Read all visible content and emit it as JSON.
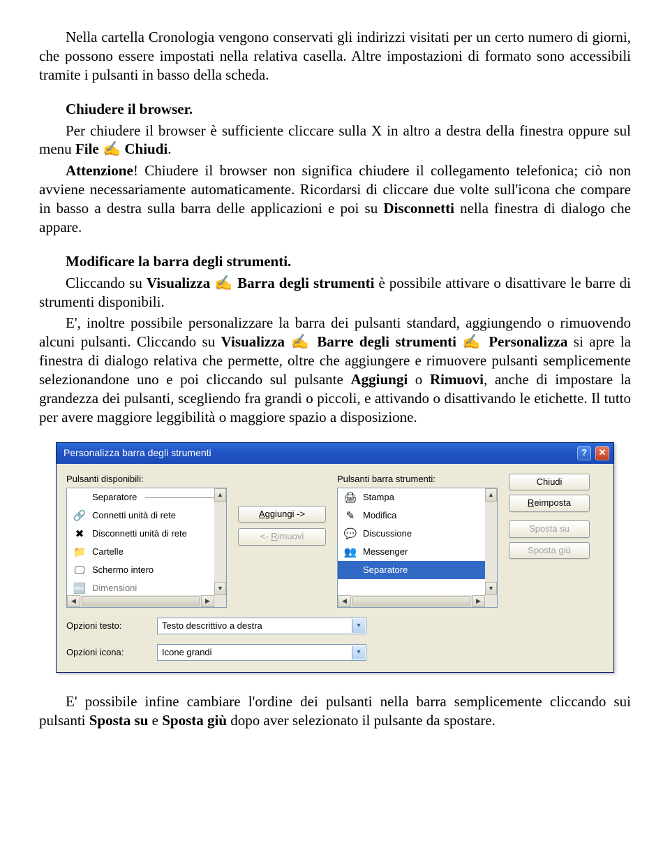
{
  "para": {
    "p1": "Nella cartella Cronologia vengono conservati gli indirizzi visitati per un certo numero di giorni, che possono essere impostati nella relativa casella. Altre impostazioni di formato sono accessibili tramite i pulsanti in basso della scheda.",
    "h1": "Chiudere il browser.",
    "p2a": "Per chiudere il browser è sufficiente cliccare sulla X in altro a destra della finestra oppure sul menu ",
    "p2b": "File ✍ Chiudi",
    "p2c": ".",
    "p3a": "Attenzione",
    "p3b": "! Chiudere il browser non significa chiudere il collegamento telefonica; ciò non avviene necessariamente automaticamente. Ricordarsi di cliccare due volte sull'icona che compare in basso a destra sulla barra delle applicazioni e poi su  ",
    "p3c": "Disconnetti",
    "p3d": " nella finestra di dialogo che appare.",
    "h2": "Modificare la barra degli strumenti.",
    "p4a": "Cliccando su ",
    "p4b": "Visualizza ✍ Barra degli strumenti",
    "p4c": " è possibile attivare o disattivare le barre di strumenti disponibili.",
    "p5a": "E', inoltre possibile personalizzare la barra dei pulsanti standard, aggiungendo o rimuovendo alcuni pulsanti. Cliccando su ",
    "p5b": "Visualizza ✍ Barre degli strumenti ✍ Personalizza",
    "p5c": " si apre la finestra di dialogo relativa che permette, oltre che aggiungere e rimuovere pulsanti semplicemente selezionandone uno e poi cliccando sul pulsante ",
    "p5d": "Aggiungi",
    "p5e": " o ",
    "p5f": "Rimuovi",
    "p5g": ", anche di impostare la grandezza dei pulsanti, scegliendo fra grandi o piccoli, e attivando o disattivando le etichette. Il tutto per avere maggiore leggibilità o maggiore spazio a disposizione.",
    "p6a": "E' possibile infine cambiare l'ordine dei pulsanti nella barra semplicemente cliccando sui pulsanti ",
    "p6b": "Sposta su",
    "p6c": " e ",
    "p6d": "Sposta giù",
    "p6e": " dopo aver selezionato il pulsante da spostare."
  },
  "dlg": {
    "title": "Personalizza barra degli strumenti",
    "labels": {
      "available": "Pulsanti disponibili:",
      "current": "Pulsanti barra strumenti:",
      "textopt": "Opzioni testo:",
      "iconopt": "Opzioni icona:"
    },
    "buttons": {
      "add": "Aggiungi ->",
      "remove": "<- Rimuovi",
      "close": "Chiudi",
      "reset": "Reimposta",
      "moveup": "Sposta su",
      "movedown": "Sposta giù"
    },
    "left_items": [
      {
        "icon": "",
        "label": "Separatore",
        "sep": true
      },
      {
        "icon": "🔗",
        "label": "Connetti unità di rete"
      },
      {
        "icon": "✖",
        "label": "Disconnetti unità di rete"
      },
      {
        "icon": "📁",
        "label": "Cartelle"
      },
      {
        "icon": "🖵",
        "label": "Schermo intero"
      },
      {
        "icon": "🔤",
        "label": "Dimensioni",
        "partial": true
      }
    ],
    "right_items": [
      {
        "icon": "🖨",
        "label": "Stampa"
      },
      {
        "icon": "✎",
        "label": "Modifica"
      },
      {
        "icon": "💬",
        "label": "Discussione"
      },
      {
        "icon": "👥",
        "label": "Messenger"
      },
      {
        "icon": "",
        "label": "Separatore",
        "sel": true,
        "sep": true
      }
    ],
    "selects": {
      "text": "Testo descrittivo a destra",
      "icon": "Icone grandi"
    }
  }
}
